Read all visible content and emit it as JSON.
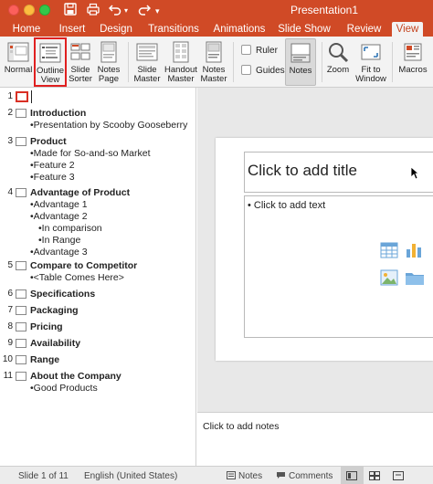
{
  "app": {
    "title": "Presentation1",
    "accent_color": "#d04a26"
  },
  "quick_access": {
    "save_icon": "save-icon",
    "undo_icon": "undo-icon",
    "redo_icon": "redo-icon",
    "more_icon": "chevron-down-icon"
  },
  "tabs": [
    {
      "label": "Home",
      "active": false
    },
    {
      "label": "Insert",
      "active": false
    },
    {
      "label": "Design",
      "active": false
    },
    {
      "label": "Transitions",
      "active": false
    },
    {
      "label": "Animations",
      "active": false
    },
    {
      "label": "Slide Show",
      "active": false
    },
    {
      "label": "Review",
      "active": false
    },
    {
      "label": "View",
      "active": true
    }
  ],
  "ribbon": {
    "normal": {
      "line1": "Normal",
      "line2": ""
    },
    "outline_view": {
      "line1": "Outline",
      "line2": "View",
      "highlighted": true
    },
    "slide_sorter": {
      "line1": "Slide",
      "line2": "Sorter"
    },
    "notes_page": {
      "line1": "Notes",
      "line2": "Page"
    },
    "slide_master": {
      "line1": "Slide",
      "line2": "Master"
    },
    "handout_master": {
      "line1": "Handout",
      "line2": "Master"
    },
    "notes_master": {
      "line1": "Notes",
      "line2": "Master"
    },
    "ruler": {
      "label": "Ruler",
      "checked": false
    },
    "guides": {
      "label": "Guides",
      "checked": false
    },
    "notes": {
      "label": "Notes",
      "active": true
    },
    "zoom": {
      "label": "Zoom"
    },
    "fit_to_window": {
      "line1": "Fit to",
      "line2": "Window"
    },
    "macros": {
      "label": "Macros"
    }
  },
  "outline": {
    "slides": [
      {
        "num": "1",
        "title": "",
        "bullets": []
      },
      {
        "num": "2",
        "title": "Introduction",
        "bullets": [
          {
            "text": "•Presentation by Scooby Gooseberry",
            "level": 1
          }
        ]
      },
      {
        "num": "3",
        "title": "Product",
        "bullets": [
          {
            "text": "•Made for So-and-so Market",
            "level": 1
          },
          {
            "text": "•Feature 2",
            "level": 1
          },
          {
            "text": "•Feature 3",
            "level": 1
          }
        ]
      },
      {
        "num": "4",
        "title": "Advantage of Product",
        "bullets": [
          {
            "text": "•Advantage 1",
            "level": 1
          },
          {
            "text": "•Advantage 2",
            "level": 1
          },
          {
            "text": "•In comparison",
            "level": 2
          },
          {
            "text": "•In Range",
            "level": 2
          },
          {
            "text": "•Advantage 3",
            "level": 1
          }
        ]
      },
      {
        "num": "5",
        "title": "Compare to Competitor",
        "bullets": [
          {
            "text": "•<Table Comes Here>",
            "level": 1
          }
        ]
      },
      {
        "num": "6",
        "title": "Specifications",
        "bullets": []
      },
      {
        "num": "7",
        "title": "Packaging",
        "bullets": []
      },
      {
        "num": "8",
        "title": "Pricing",
        "bullets": []
      },
      {
        "num": "9",
        "title": "Availability",
        "bullets": []
      },
      {
        "num": "10",
        "title": "Range",
        "bullets": []
      },
      {
        "num": "11",
        "title": "About the Company",
        "bullets": [
          {
            "text": "•Good Products",
            "level": 1
          }
        ]
      }
    ]
  },
  "slide": {
    "title_placeholder": "Click to add title",
    "body_placeholder": "• Click to add text"
  },
  "notes_pane": {
    "placeholder": "Click to add notes"
  },
  "status": {
    "slide_count": "Slide 1 of 11",
    "language": "English (United States)",
    "notes_label": "Notes",
    "comments_label": "Comments"
  }
}
